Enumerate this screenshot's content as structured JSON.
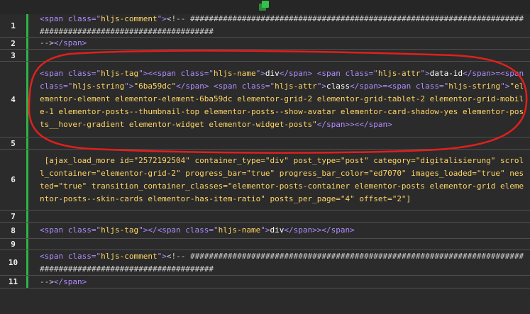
{
  "toolbar": {
    "icon": "copy-icon"
  },
  "lines": [
    {
      "n": "1",
      "parts": [
        [
          "tag",
          "<span class=\""
        ],
        [
          "str",
          "hljs-comment"
        ],
        [
          "tag",
          "\">"
        ],
        [
          "cm",
          "<!-- ############################################################################################################"
        ]
      ]
    },
    {
      "n": "2",
      "parts": [
        [
          "cm",
          "-->"
        ],
        [
          "tag",
          "</span>"
        ]
      ]
    },
    {
      "n": "3",
      "parts": []
    },
    {
      "n": "4",
      "parts": [
        [
          "tag",
          "<span class=\""
        ],
        [
          "str",
          "hljs-tag"
        ],
        [
          "tag",
          "\"><<span class=\""
        ],
        [
          "str",
          "hljs-name"
        ],
        [
          "tag",
          "\">"
        ],
        [
          "txt",
          "div"
        ],
        [
          "tag",
          "</span> <span class=\""
        ],
        [
          "str",
          "hljs-attr"
        ],
        [
          "tag",
          "\">"
        ],
        [
          "txt",
          "data-id"
        ],
        [
          "tag",
          "</span>=<span class=\""
        ],
        [
          "str",
          "hljs-string"
        ],
        [
          "tag",
          "\">"
        ],
        [
          "str",
          "\"6ba59dc\""
        ],
        [
          "tag",
          "</span> <span class=\""
        ],
        [
          "str",
          "hljs-attr"
        ],
        [
          "tag",
          "\">"
        ],
        [
          "txt",
          "class"
        ],
        [
          "tag",
          "</span>=<span class=\""
        ],
        [
          "str",
          "hljs-string"
        ],
        [
          "tag",
          "\">"
        ],
        [
          "str",
          "\"elementor-element elementor-element-6ba59dc elementor-grid-2 elementor-grid-tablet-2 elementor-grid-mobile-1 elementor-posts--thumbnail-top elementor-posts--show-avatar elementor-card-shadow-yes elementor-posts__hover-gradient elementor-widget elementor-widget-posts\""
        ],
        [
          "tag",
          "</span>><</span>"
        ]
      ]
    },
    {
      "n": "5",
      "parts": []
    },
    {
      "n": "6",
      "parts": [
        [
          "str",
          " [ajax_load_more id=\"2572192504\" container_type=\"div\" post_type=\"post\" category=\"digitalisierung\" scroll_container=\"elementor-grid-2\" progress_bar=\"true\" progress_bar_color=\"ed7070\" images_loaded=\"true\" nested=\"true\" transition_container_classes=\"elementor-posts-container elementor-posts elementor-grid elementor-posts--skin-cards elementor-has-item-ratio\" posts_per_page=\"4\" offset=\"2\"]"
        ]
      ]
    },
    {
      "n": "7",
      "parts": []
    },
    {
      "n": "8",
      "parts": [
        [
          "tag",
          "<span class=\""
        ],
        [
          "str",
          "hljs-tag"
        ],
        [
          "tag",
          "\"></<span class=\""
        ],
        [
          "str",
          "hljs-name"
        ],
        [
          "tag",
          "\">"
        ],
        [
          "txt",
          "div"
        ],
        [
          "tag",
          "</span>></span>"
        ]
      ]
    },
    {
      "n": "9",
      "parts": []
    },
    {
      "n": "10",
      "parts": [
        [
          "tag",
          "<span class=\""
        ],
        [
          "str",
          "hljs-comment"
        ],
        [
          "tag",
          "\">"
        ],
        [
          "cm",
          "<!-- ############################################################################################################"
        ]
      ]
    },
    {
      "n": "11",
      "parts": [
        [
          "cm",
          "-->"
        ],
        [
          "tag",
          "</span>"
        ]
      ]
    }
  ],
  "colors": {
    "background": "#2b2b2b",
    "gutter_accent": "#2fb34a",
    "tag": "#b08cff",
    "string": "#ffd566",
    "annotation": "#e0201c"
  }
}
